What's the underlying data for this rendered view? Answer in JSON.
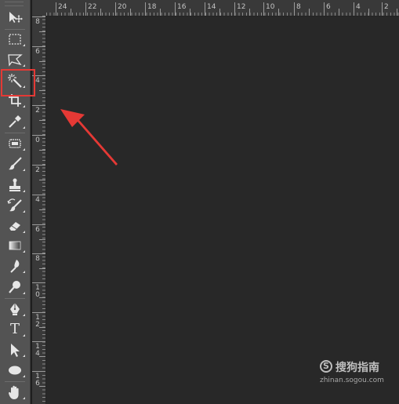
{
  "rulers": {
    "top_labels": [
      "24",
      "22",
      "20",
      "18",
      "16",
      "14",
      "12",
      "10",
      "8",
      "6",
      "4",
      "2"
    ],
    "left_labels": [
      "8",
      "6",
      "4",
      "2",
      "0",
      "2",
      "4",
      "6",
      "8",
      "1\n0",
      "1\n2",
      "1\n4",
      "1\n6"
    ]
  },
  "toolbar": {
    "tools": [
      {
        "name": "move-tool",
        "icon": "move-icon"
      },
      {
        "name": "rectangular-marquee-tool",
        "icon": "marquee-icon"
      },
      {
        "name": "lasso-tool",
        "icon": "polygonal-lasso-icon"
      },
      {
        "name": "magic-wand-tool",
        "icon": "magic-wand-icon",
        "highlighted": true
      },
      {
        "name": "crop-tool",
        "icon": "crop-icon"
      },
      {
        "name": "eyedropper-tool",
        "icon": "eyedropper-icon"
      },
      {
        "name": "spot-healing-tool",
        "icon": "healing-brush-icon"
      },
      {
        "name": "brush-tool",
        "icon": "brush-icon"
      },
      {
        "name": "clone-stamp-tool",
        "icon": "stamp-icon"
      },
      {
        "name": "history-brush-tool",
        "icon": "history-brush-icon"
      },
      {
        "name": "eraser-tool",
        "icon": "eraser-icon"
      },
      {
        "name": "gradient-tool",
        "icon": "gradient-icon"
      },
      {
        "name": "blur-tool",
        "icon": "blur-icon"
      },
      {
        "name": "dodge-tool",
        "icon": "dodge-icon"
      },
      {
        "name": "pen-tool",
        "icon": "pen-icon"
      },
      {
        "name": "type-tool",
        "icon": "type-icon",
        "glyph": "T"
      },
      {
        "name": "path-selection-tool",
        "icon": "arrow-icon"
      },
      {
        "name": "ellipse-tool",
        "icon": "ellipse-icon"
      },
      {
        "name": "hand-tool",
        "icon": "hand-icon"
      }
    ]
  },
  "annotation": {
    "highlight_color": "#e53935",
    "arrow_color": "#e53935",
    "arrow_icon": "arrow-pointer-icon"
  },
  "watermark": {
    "logo_letter": "S",
    "brand": "搜狗指南",
    "url": "zhinan.sogou.com"
  },
  "colors": {
    "toolbar_bg": "#535353",
    "canvas_bg": "#282828",
    "ruler_bg": "#393939"
  }
}
